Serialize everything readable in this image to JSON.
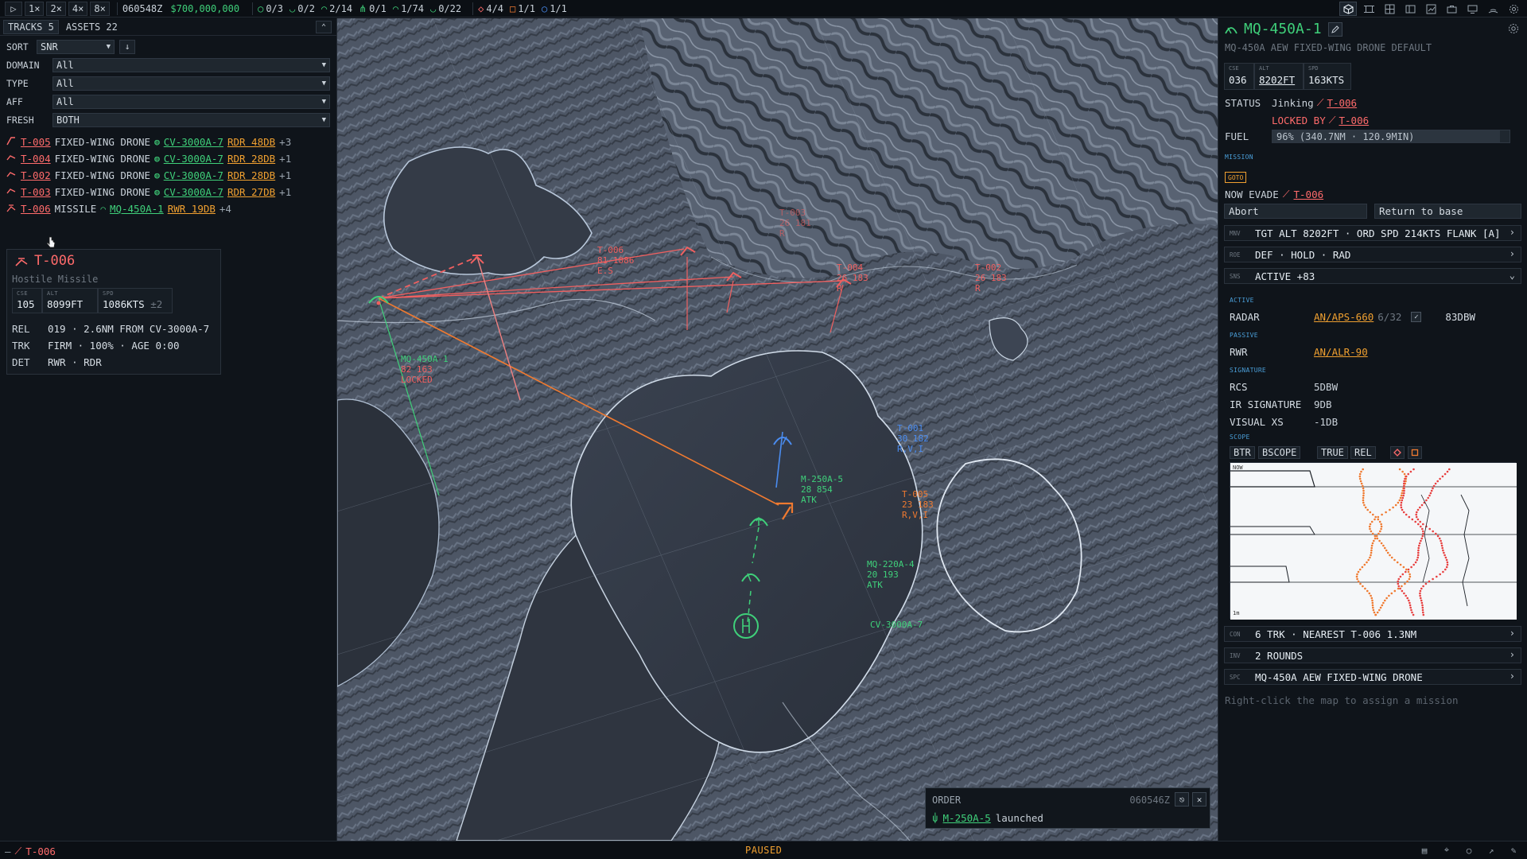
{
  "topbar": {
    "play": "▷",
    "speeds": [
      "1×",
      "2×",
      "4×",
      "8×"
    ],
    "time": "060548Z",
    "budget": "$700,000,000",
    "counters": [
      {
        "icon": "ring-icon",
        "glyph": "○",
        "value": "0/3"
      },
      {
        "icon": "arc-down-icon",
        "glyph": "◡",
        "value": "0/2"
      },
      {
        "icon": "arc-up-icon",
        "glyph": "◠",
        "value": "2/14"
      },
      {
        "icon": "fork-icon",
        "glyph": "⋔",
        "value": "0/1"
      },
      {
        "icon": "arc-dot-icon",
        "glyph": "◠",
        "value": "1/74"
      },
      {
        "icon": "arc-down-dot-icon",
        "glyph": "◡",
        "value": "0/22"
      }
    ],
    "hostile_counters": [
      {
        "icon": "diamond-icon",
        "glyph": "◇",
        "value": "4/4"
      },
      {
        "icon": "square-icon",
        "glyph": "□",
        "value": "1/1"
      },
      {
        "icon": "circle-icon",
        "glyph": "○",
        "value": "1/1"
      }
    ]
  },
  "left": {
    "tabs": [
      {
        "label": "TRACKS",
        "count": "5"
      },
      {
        "label": "ASSETS",
        "count": "22"
      }
    ],
    "collapse": "⌃",
    "sort": {
      "label": "SORT",
      "value": "SNR",
      "dir": "↓"
    },
    "filters": [
      {
        "label": "DOMAIN",
        "value": "All"
      },
      {
        "label": "TYPE",
        "value": "All"
      },
      {
        "label": "AFF",
        "value": "All"
      },
      {
        "label": "FRESH",
        "value": "BOTH"
      }
    ],
    "tracks": [
      {
        "id": "T-005",
        "type": "FIXED-WING DRONE",
        "asset": "CV-3000A-7",
        "sensor": "RDR 48DB",
        "more": "+3"
      },
      {
        "id": "T-004",
        "type": "FIXED-WING DRONE",
        "asset": "CV-3000A-7",
        "sensor": "RDR 28DB",
        "more": "+1"
      },
      {
        "id": "T-002",
        "type": "FIXED-WING DRONE",
        "asset": "CV-3000A-7",
        "sensor": "RDR 28DB",
        "more": "+1"
      },
      {
        "id": "T-003",
        "type": "FIXED-WING DRONE",
        "asset": "CV-3000A-7",
        "sensor": "RDR 27DB",
        "more": "+1"
      },
      {
        "id": "T-006",
        "type": "MISSILE",
        "asset": "MQ-450A-1",
        "sensor": "RWR 19DB",
        "more": "+4"
      }
    ],
    "tooltip": {
      "title": "T-006",
      "subtitle": "Hostile Missile",
      "stats": [
        {
          "label": "CSE",
          "value": "105"
        },
        {
          "label": "ALT",
          "value": "8099FT"
        },
        {
          "label": "SPD",
          "value": "1086KTS",
          "extra": "±2"
        }
      ],
      "rows": [
        {
          "k": "REL",
          "v": "019 · 2.6NM FROM CV-3000A-7"
        },
        {
          "k": "TRK",
          "v": "FIRM · 100% · AGE 0:00"
        },
        {
          "k": "DET",
          "v": "RWR · RDR"
        }
      ]
    }
  },
  "map": {
    "labels": [
      {
        "id": "t006",
        "lines": [
          "T-006",
          "81 1086",
          "E.S"
        ]
      },
      {
        "id": "t003",
        "lines": [
          "T-003",
          "26 181",
          "R"
        ]
      },
      {
        "id": "t004",
        "lines": [
          "T-004",
          "26 183",
          "R"
        ]
      },
      {
        "id": "t002",
        "lines": [
          "T-002",
          "26 183",
          "R"
        ]
      },
      {
        "id": "mq450",
        "lines": [
          "MQ-450A-1",
          "82 163",
          "LOCKED"
        ]
      },
      {
        "id": "t001",
        "lines": [
          "T-001",
          "30 182",
          "R,V,I"
        ]
      },
      {
        "id": "m250",
        "lines": [
          "M-250A-5",
          "28 854",
          "ATK"
        ]
      },
      {
        "id": "t005",
        "lines": [
          "T-005",
          "23 183",
          "R,V,I"
        ]
      },
      {
        "id": "mq220",
        "lines": [
          "MQ-220A-4",
          "20 193",
          "ATK"
        ]
      },
      {
        "id": "cv3000",
        "lines": [
          "CV-3000A-7"
        ]
      }
    ]
  },
  "order": {
    "title": "ORDER",
    "time": "060546Z",
    "asset": "M-250A-5",
    "text": "launched"
  },
  "right": {
    "title": "MQ-450A-1",
    "subtitle": "MQ-450A AEW FIXED-WING DRONE DEFAULT",
    "stats": [
      {
        "label": "CSE",
        "value": "036"
      },
      {
        "label": "ALT",
        "value": "8202FT"
      },
      {
        "label": "SPD",
        "value": "163KTS"
      }
    ],
    "status": {
      "label": "STATUS",
      "value": "Jinking",
      "target": "T-006"
    },
    "locked": {
      "label": "LOCKED BY",
      "target": "T-006"
    },
    "fuel": {
      "label": "FUEL",
      "text": "96% (340.7NM · 120.9MIN)",
      "percent": 96
    },
    "mission_label": "MISSION",
    "goto_tag": "GOTO",
    "now": {
      "label": "NOW EVADE",
      "target": "T-006"
    },
    "actions": [
      "Abort",
      "Return to base"
    ],
    "mnv": {
      "tag": "MNV",
      "text": "TGT ALT 8202FT · ORD SPD 214KTS FLANK [A]"
    },
    "roe": {
      "tag": "ROE",
      "text": "DEF · HOLD · RAD"
    },
    "sns": {
      "tag": "SNS",
      "text": "ACTIVE +83"
    },
    "active_label": "ACTIVE",
    "radar": {
      "k": "RADAR",
      "name": "AN/APS-660",
      "ratio": "6/32",
      "power": "83DBW"
    },
    "passive_label": "PASSIVE",
    "rwr": {
      "k": "RWR",
      "name": "AN/ALR-90"
    },
    "signature_label": "SIGNATURE",
    "signatures": [
      {
        "k": "RCS",
        "v": "5DBW"
      },
      {
        "k": "IR SIGNATURE",
        "v": "9DB"
      },
      {
        "k": "VISUAL XS",
        "v": "-1DB"
      }
    ],
    "scope_label": "SCOPE",
    "scope_buttons": [
      "BTR",
      "BSCOPE",
      "TRUE",
      "REL"
    ],
    "scope_now": "NOW",
    "scope_end": "1m",
    "con": {
      "tag": "CON",
      "text": "6 TRK · NEAREST T-006 1.3NM"
    },
    "inv": {
      "tag": "INV",
      "text": "2 ROUNDS"
    },
    "spc": {
      "tag": "SPC",
      "text": "MQ-450A AEW FIXED-WING DRONE"
    },
    "hint": "Right-click the map to assign a mission"
  },
  "bottombar": {
    "left_prefix": "–",
    "left_track": "T-006",
    "center": "PAUSED"
  },
  "colors": {
    "hostile": "#ff6b6b",
    "friendly": "#3fd07a",
    "unknown": "#4a8cf0",
    "selected": "#f07a30",
    "accent": "#f0a030"
  }
}
